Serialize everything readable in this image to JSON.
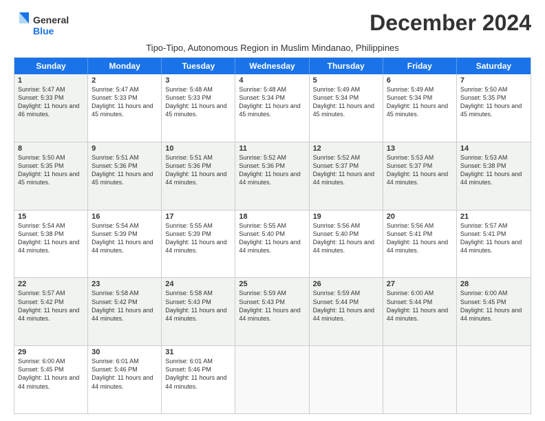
{
  "header": {
    "logo_general": "General",
    "logo_blue": "Blue",
    "month_title": "December 2024",
    "subtitle": "Tipo-Tipo, Autonomous Region in Muslim Mindanao, Philippines"
  },
  "calendar": {
    "days_of_week": [
      "Sunday",
      "Monday",
      "Tuesday",
      "Wednesday",
      "Thursday",
      "Friday",
      "Saturday"
    ],
    "weeks": [
      [
        {
          "day": "",
          "sunrise": "",
          "sunset": "",
          "daylight": "",
          "empty": true
        },
        {
          "day": "2",
          "sunrise": "Sunrise: 5:47 AM",
          "sunset": "Sunset: 5:33 PM",
          "daylight": "Daylight: 11 hours and 45 minutes.",
          "shaded": false
        },
        {
          "day": "3",
          "sunrise": "Sunrise: 5:48 AM",
          "sunset": "Sunset: 5:33 PM",
          "daylight": "Daylight: 11 hours and 45 minutes.",
          "shaded": false
        },
        {
          "day": "4",
          "sunrise": "Sunrise: 5:48 AM",
          "sunset": "Sunset: 5:34 PM",
          "daylight": "Daylight: 11 hours and 45 minutes.",
          "shaded": false
        },
        {
          "day": "5",
          "sunrise": "Sunrise: 5:49 AM",
          "sunset": "Sunset: 5:34 PM",
          "daylight": "Daylight: 11 hours and 45 minutes.",
          "shaded": false
        },
        {
          "day": "6",
          "sunrise": "Sunrise: 5:49 AM",
          "sunset": "Sunset: 5:34 PM",
          "daylight": "Daylight: 11 hours and 45 minutes.",
          "shaded": false
        },
        {
          "day": "7",
          "sunrise": "Sunrise: 5:50 AM",
          "sunset": "Sunset: 5:35 PM",
          "daylight": "Daylight: 11 hours and 45 minutes.",
          "shaded": false
        }
      ],
      [
        {
          "day": "1",
          "sunrise": "Sunrise: 5:47 AM",
          "sunset": "Sunset: 5:33 PM",
          "daylight": "Daylight: 11 hours and 46 minutes.",
          "shaded": true
        },
        {
          "day": "8",
          "sunrise": "Sunrise: 5:50 AM",
          "sunset": "Sunset: 5:35 PM",
          "daylight": "Daylight: 11 hours and 45 minutes.",
          "shaded": true
        },
        {
          "day": "9",
          "sunrise": "Sunrise: 5:51 AM",
          "sunset": "Sunset: 5:36 PM",
          "daylight": "Daylight: 11 hours and 45 minutes.",
          "shaded": true
        },
        {
          "day": "10",
          "sunrise": "Sunrise: 5:51 AM",
          "sunset": "Sunset: 5:36 PM",
          "daylight": "Daylight: 11 hours and 44 minutes.",
          "shaded": true
        },
        {
          "day": "11",
          "sunrise": "Sunrise: 5:52 AM",
          "sunset": "Sunset: 5:36 PM",
          "daylight": "Daylight: 11 hours and 44 minutes.",
          "shaded": true
        },
        {
          "day": "12",
          "sunrise": "Sunrise: 5:52 AM",
          "sunset": "Sunset: 5:37 PM",
          "daylight": "Daylight: 11 hours and 44 minutes.",
          "shaded": true
        },
        {
          "day": "13",
          "sunrise": "Sunrise: 5:53 AM",
          "sunset": "Sunset: 5:37 PM",
          "daylight": "Daylight: 11 hours and 44 minutes.",
          "shaded": true
        }
      ],
      [
        {
          "day": "14",
          "sunrise": "Sunrise: 5:53 AM",
          "sunset": "Sunset: 5:38 PM",
          "daylight": "Daylight: 11 hours and 44 minutes.",
          "shaded": false
        },
        {
          "day": "15",
          "sunrise": "Sunrise: 5:54 AM",
          "sunset": "Sunset: 5:38 PM",
          "daylight": "Daylight: 11 hours and 44 minutes.",
          "shaded": false
        },
        {
          "day": "16",
          "sunrise": "Sunrise: 5:54 AM",
          "sunset": "Sunset: 5:39 PM",
          "daylight": "Daylight: 11 hours and 44 minutes.",
          "shaded": false
        },
        {
          "day": "17",
          "sunrise": "Sunrise: 5:55 AM",
          "sunset": "Sunset: 5:39 PM",
          "daylight": "Daylight: 11 hours and 44 minutes.",
          "shaded": false
        },
        {
          "day": "18",
          "sunrise": "Sunrise: 5:55 AM",
          "sunset": "Sunset: 5:40 PM",
          "daylight": "Daylight: 11 hours and 44 minutes.",
          "shaded": false
        },
        {
          "day": "19",
          "sunrise": "Sunrise: 5:56 AM",
          "sunset": "Sunset: 5:40 PM",
          "daylight": "Daylight: 11 hours and 44 minutes.",
          "shaded": false
        },
        {
          "day": "20",
          "sunrise": "Sunrise: 5:56 AM",
          "sunset": "Sunset: 5:41 PM",
          "daylight": "Daylight: 11 hours and 44 minutes.",
          "shaded": false
        }
      ],
      [
        {
          "day": "21",
          "sunrise": "Sunrise: 5:57 AM",
          "sunset": "Sunset: 5:41 PM",
          "daylight": "Daylight: 11 hours and 44 minutes.",
          "shaded": true
        },
        {
          "day": "22",
          "sunrise": "Sunrise: 5:57 AM",
          "sunset": "Sunset: 5:42 PM",
          "daylight": "Daylight: 11 hours and 44 minutes.",
          "shaded": true
        },
        {
          "day": "23",
          "sunrise": "Sunrise: 5:58 AM",
          "sunset": "Sunset: 5:42 PM",
          "daylight": "Daylight: 11 hours and 44 minutes.",
          "shaded": true
        },
        {
          "day": "24",
          "sunrise": "Sunrise: 5:58 AM",
          "sunset": "Sunset: 5:43 PM",
          "daylight": "Daylight: 11 hours and 44 minutes.",
          "shaded": true
        },
        {
          "day": "25",
          "sunrise": "Sunrise: 5:59 AM",
          "sunset": "Sunset: 5:43 PM",
          "daylight": "Daylight: 11 hours and 44 minutes.",
          "shaded": true
        },
        {
          "day": "26",
          "sunrise": "Sunrise: 5:59 AM",
          "sunset": "Sunset: 5:44 PM",
          "daylight": "Daylight: 11 hours and 44 minutes.",
          "shaded": true
        },
        {
          "day": "27",
          "sunrise": "Sunrise: 6:00 AM",
          "sunset": "Sunset: 5:44 PM",
          "daylight": "Daylight: 11 hours and 44 minutes.",
          "shaded": true
        }
      ],
      [
        {
          "day": "28",
          "sunrise": "Sunrise: 6:00 AM",
          "sunset": "Sunset: 5:45 PM",
          "daylight": "Daylight: 11 hours and 44 minutes.",
          "shaded": false
        },
        {
          "day": "29",
          "sunrise": "Sunrise: 6:00 AM",
          "sunset": "Sunset: 5:45 PM",
          "daylight": "Daylight: 11 hours and 44 minutes.",
          "shaded": false
        },
        {
          "day": "30",
          "sunrise": "Sunrise: 6:01 AM",
          "sunset": "Sunset: 5:46 PM",
          "daylight": "Daylight: 11 hours and 44 minutes.",
          "shaded": false
        },
        {
          "day": "31",
          "sunrise": "Sunrise: 6:01 AM",
          "sunset": "Sunset: 5:46 PM",
          "daylight": "Daylight: 11 hours and 44 minutes.",
          "shaded": false
        },
        {
          "day": "",
          "sunrise": "",
          "sunset": "",
          "daylight": "",
          "empty": true
        },
        {
          "day": "",
          "sunrise": "",
          "sunset": "",
          "daylight": "",
          "empty": true
        },
        {
          "day": "",
          "sunrise": "",
          "sunset": "",
          "daylight": "",
          "empty": true
        }
      ]
    ]
  }
}
